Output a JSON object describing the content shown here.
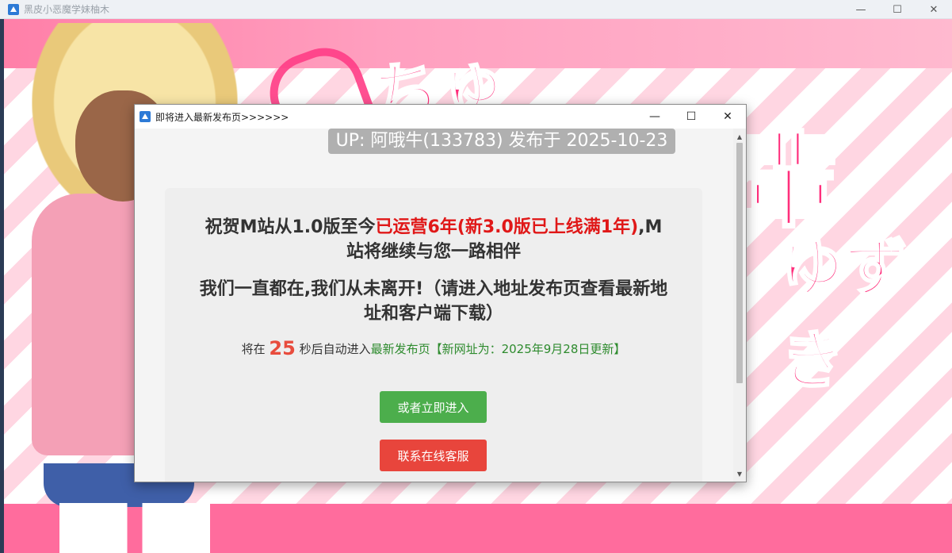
{
  "window": {
    "title": "黑皮小恶魔学妹柚木",
    "controls": {
      "minimize": "—",
      "maximize": "☐",
      "close": "✕"
    }
  },
  "background_art": {
    "lettering": [
      "ちゅ",
      "輩",
      "ゆずき"
    ]
  },
  "dialog": {
    "title": "即将进入最新发布页>>>>>>",
    "controls": {
      "minimize": "—",
      "maximize": "☐",
      "close": "✕"
    },
    "upbar": "UP: 阿哦牛(133783) 发布于 2025-10-23",
    "headline": {
      "part1": "祝贺M站从1.0版至今",
      "highlight": "已运营6年(新3.0版已上线满1年)",
      "part2": ",M站将继续与您一路相伴"
    },
    "headline2": "我们一直都在,我们从未离开!（请进入地址发布页查看最新地址和客户端下载）",
    "countdown": {
      "prefix": "将在 ",
      "seconds": "25",
      "middle": " 秒后自动进入",
      "link": "最新发布页【新网址为：2025年9月28日更新】"
    },
    "buttons": {
      "enter_now": "或者立即进入",
      "contact_support": "联系在线客服"
    }
  },
  "colors": {
    "highlight_red": "#e01818",
    "countdown_number": "#e84c3d",
    "link_green": "#2e8b2e",
    "button_green": "#4cae4c",
    "button_red": "#e8453c"
  }
}
